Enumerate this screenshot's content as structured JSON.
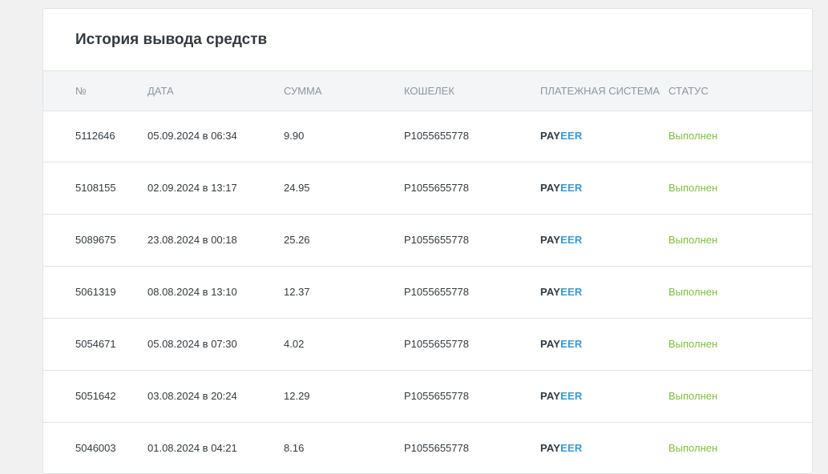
{
  "title": "История вывода средств",
  "columns": {
    "num": "№",
    "date": "ДАТА",
    "sum": "СУММА",
    "wallet": "КОШЕЛЕК",
    "system": "ПЛАТЕЖНАЯ СИСТЕМА",
    "status": "СТАТУС"
  },
  "payment_logo": {
    "part1": "PAY",
    "part2": "EER",
    "color_dark": "#2e3a46",
    "color_blue": "#3a98d9"
  },
  "status_color": "#7fbf3f",
  "rows": [
    {
      "num": "5112646",
      "date": "05.09.2024 в 06:34",
      "sum": "9.90",
      "wallet": "P1055655778",
      "status": "Выполнен"
    },
    {
      "num": "5108155",
      "date": "02.09.2024 в 13:17",
      "sum": "24.95",
      "wallet": "P1055655778",
      "status": "Выполнен"
    },
    {
      "num": "5089675",
      "date": "23.08.2024 в 00:18",
      "sum": "25.26",
      "wallet": "P1055655778",
      "status": "Выполнен"
    },
    {
      "num": "5061319",
      "date": "08.08.2024 в 13:10",
      "sum": "12.37",
      "wallet": "P1055655778",
      "status": "Выполнен"
    },
    {
      "num": "5054671",
      "date": "05.08.2024 в 07:30",
      "sum": "4.02",
      "wallet": "P1055655778",
      "status": "Выполнен"
    },
    {
      "num": "5051642",
      "date": "03.08.2024 в 20:24",
      "sum": "12.29",
      "wallet": "P1055655778",
      "status": "Выполнен"
    },
    {
      "num": "5046003",
      "date": "01.08.2024 в 04:21",
      "sum": "8.16",
      "wallet": "P1055655778",
      "status": "Выполнен"
    }
  ]
}
